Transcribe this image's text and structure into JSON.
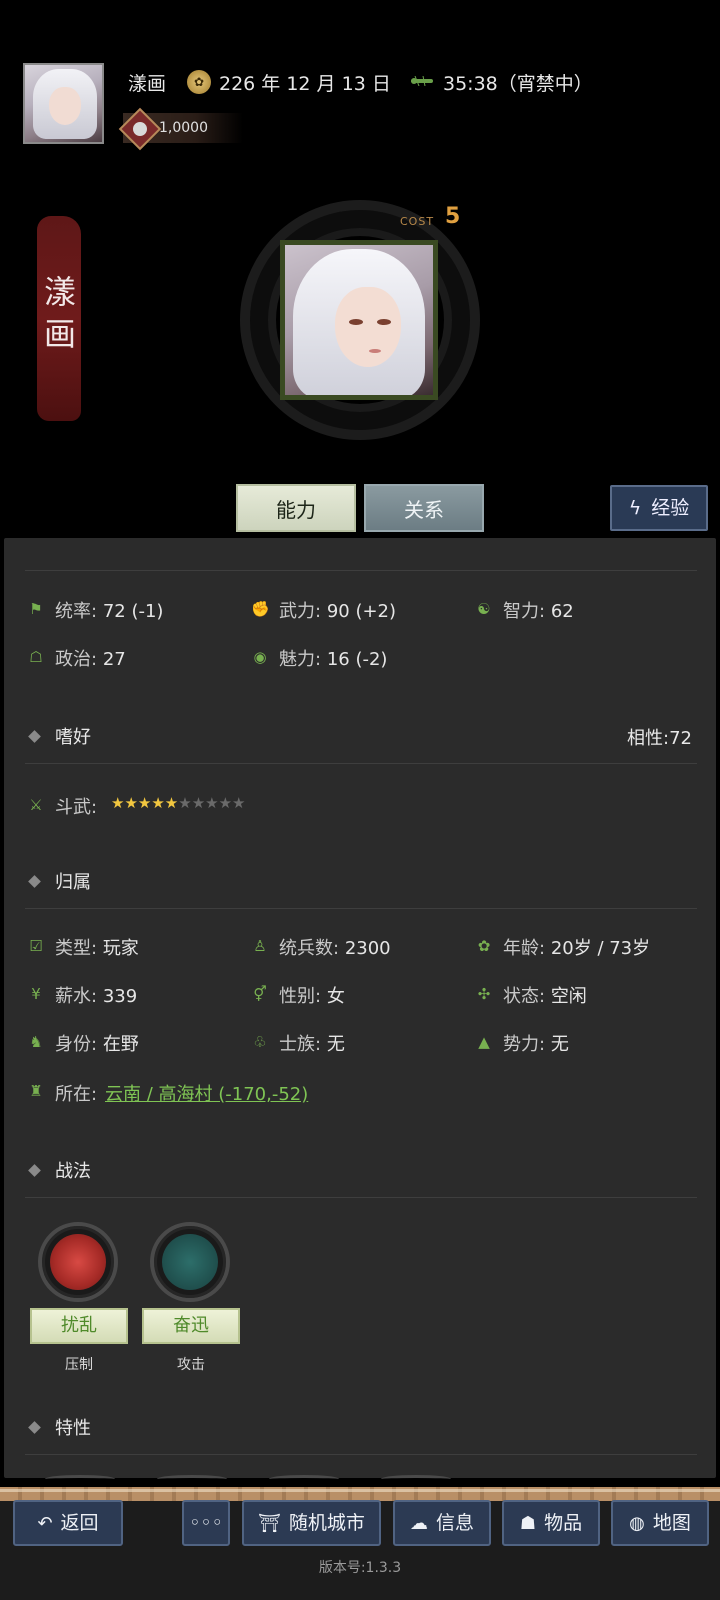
{
  "header": {
    "name": "漾画",
    "date": "226 年 12 月 13 日",
    "time": "35:38（宵禁中）",
    "coins": "1,0000"
  },
  "character": {
    "banner_name_line1": "漾",
    "banner_name_line2": "画",
    "cost_label": "COST",
    "cost_value": "5"
  },
  "tabs": {
    "ability": "能力",
    "relation": "关系",
    "experience": "经验"
  },
  "stats": {
    "command": {
      "label": "统率:",
      "value": "72 (-1)"
    },
    "force": {
      "label": "武力:",
      "value": "90 (+2)"
    },
    "intellect": {
      "label": "智力:",
      "value": "62"
    },
    "politics": {
      "label": "政治:",
      "value": "27"
    },
    "charm": {
      "label": "魅力:",
      "value": "16 (-2)"
    }
  },
  "hobby": {
    "title": "嗜好",
    "affinity": "相性:72"
  },
  "duel": {
    "label": "斗武:",
    "stars_on": 5,
    "stars_total": 10
  },
  "belong": {
    "title": "归属",
    "type": {
      "label": "类型:",
      "value": "玩家"
    },
    "troops": {
      "label": "统兵数:",
      "value": "2300"
    },
    "age": {
      "label": "年龄:",
      "value": "20岁 / 73岁"
    },
    "salary": {
      "label": "薪水:",
      "value": "339"
    },
    "gender": {
      "label": "性别:",
      "value": "女"
    },
    "status": {
      "label": "状态:",
      "value": "空闲"
    },
    "identity": {
      "label": "身份:",
      "value": "在野"
    },
    "clan": {
      "label": "士族:",
      "value": "无"
    },
    "faction": {
      "label": "势力:",
      "value": "无"
    },
    "location": {
      "label": "所在:",
      "value": "云南 / 高海村 (-170,-52)"
    }
  },
  "tactics": {
    "title": "战法",
    "items": [
      {
        "name": "扰乱",
        "type": "压制"
      },
      {
        "name": "奋迅",
        "type": "攻击"
      }
    ]
  },
  "traits": {
    "title": "特性"
  },
  "nav": {
    "back": "返回",
    "more": "◦◦◦",
    "random_city": "随机城市",
    "info": "信息",
    "items": "物品",
    "map": "地图"
  },
  "version": "版本号:1.3.3",
  "colors": {
    "panel": "#2b2b2b",
    "accent_green": "#7fc454",
    "nav_blue": "#2c3a53",
    "star": "#f2c740"
  }
}
